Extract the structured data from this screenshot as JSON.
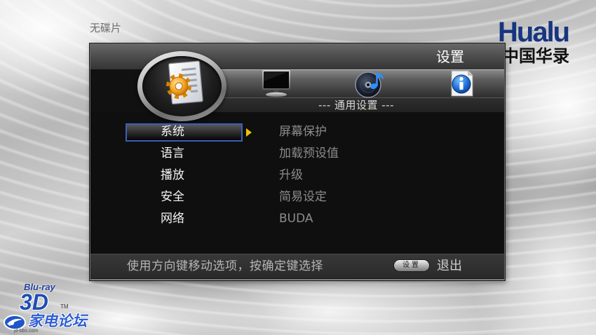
{
  "status": {
    "disc_state": "无碟片"
  },
  "brand": {
    "logo_text": "Hualu",
    "subtitle": "中国华录"
  },
  "settings": {
    "title": "设置",
    "section_title": "--- 通用设置 ---",
    "tabs": [
      {
        "icon": "general-settings-icon",
        "selected": true
      },
      {
        "icon": "display-monitor-icon",
        "selected": false
      },
      {
        "icon": "audio-disc-icon",
        "selected": false
      },
      {
        "icon": "info-icon",
        "selected": false
      }
    ],
    "menu": [
      {
        "label": "系统",
        "selected": true
      },
      {
        "label": "语言",
        "selected": false
      },
      {
        "label": "播放",
        "selected": false
      },
      {
        "label": "安全",
        "selected": false
      },
      {
        "label": "网络",
        "selected": false
      }
    ],
    "submenu": [
      {
        "label": "屏幕保护"
      },
      {
        "label": "加载预设值"
      },
      {
        "label": "升级"
      },
      {
        "label": "简易设定"
      },
      {
        "label": "BUDA"
      }
    ],
    "footer": {
      "hint": "使用方向键移动选项，按确定键选择",
      "key_label": "设置",
      "action_label": "退出"
    }
  },
  "watermarks": {
    "bluray_text": "Blu-ray",
    "bluray_3d": "3D",
    "trademark": "TM",
    "forum_name": "家电论坛",
    "forum_url": "jd-bbs.com"
  },
  "colors": {
    "brand_blue": "#17357f",
    "panel_bg": "#111111",
    "selection_border": "#3d5db8",
    "arrow": "#f2c200",
    "submenu_text": "#8c8c8c",
    "hint_text": "#b5b5b5"
  }
}
